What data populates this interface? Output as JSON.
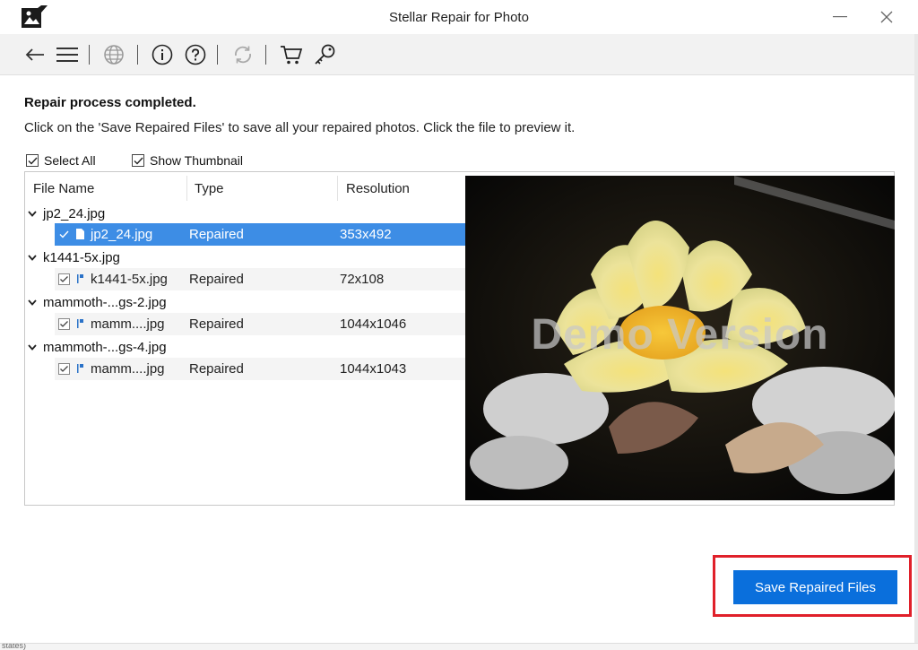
{
  "window": {
    "title": "Stellar Repair for Photo",
    "minimize_icon": "minimize-icon",
    "close_icon": "close-icon"
  },
  "toolbar": {
    "icons": [
      "back-arrow-icon",
      "menu-icon",
      "globe-icon",
      "info-icon",
      "help-icon",
      "refresh-icon",
      "cart-icon",
      "key-icon"
    ]
  },
  "status": {
    "heading": "Repair process completed.",
    "text": "Click on the 'Save Repaired Files' to save all your repaired photos. Click the file to preview it."
  },
  "options": {
    "select_all": "Select All",
    "show_thumbnail": "Show Thumbnail"
  },
  "table": {
    "columns": [
      "File Name",
      "Type",
      "Resolution"
    ],
    "groups": [
      {
        "name": "jp2_24.jpg",
        "file": {
          "name": "jp2_24.jpg",
          "type": "Repaired",
          "resolution": "353x492",
          "selected": true
        }
      },
      {
        "name": "k1441-5x.jpg",
        "file": {
          "name": "k1441-5x.jpg",
          "type": "Repaired",
          "resolution": "72x108",
          "selected": false
        }
      },
      {
        "name": "mammoth-...gs-2.jpg",
        "file": {
          "name": "mamm....jpg",
          "type": "Repaired",
          "resolution": "1044x1046",
          "selected": false
        }
      },
      {
        "name": "mammoth-...gs-4.jpg",
        "file": {
          "name": "mamm....jpg",
          "type": "Repaired",
          "resolution": "1044x1043",
          "selected": false
        }
      }
    ]
  },
  "preview": {
    "watermark": "Demo Version"
  },
  "actions": {
    "save_label": "Save Repaired Files"
  },
  "bottom": {
    "partial_text": "states)"
  },
  "colors": {
    "accent": "#0a6fdc",
    "selection": "#3d8de5",
    "highlight": "#e0202a"
  }
}
